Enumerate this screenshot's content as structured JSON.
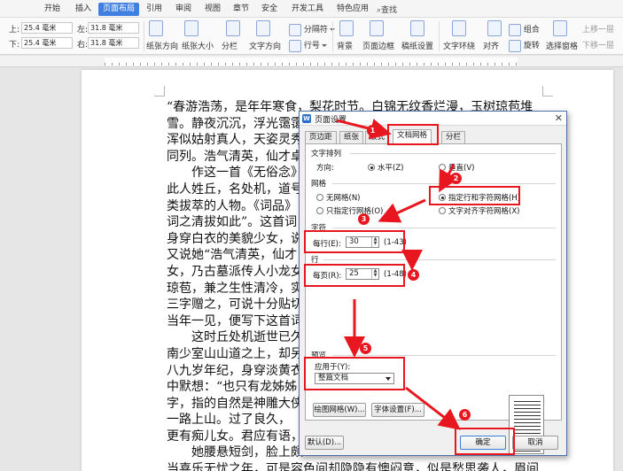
{
  "ribbon": {
    "tabs": [
      "开始",
      "插入",
      "页面布局",
      "引用",
      "审阅",
      "视图",
      "章节",
      "安全",
      "开发工具",
      "特色应用"
    ],
    "active_tab": "页面布局",
    "search_label": "查找",
    "margins": {
      "top_label": "上:",
      "top_value": "25.4 毫米",
      "bottom_label": "下:",
      "bottom_value": "25.4 毫米",
      "left_label": "左:",
      "left_value": "31.8 毫米",
      "right_label": "右:",
      "right_value": "31.8 毫米"
    },
    "tools": {
      "paper_direction": "纸张方向",
      "paper_size": "纸张大小",
      "columns": "分栏",
      "text_direction": "文字方向",
      "separator": "分隔符",
      "line_number": "行号",
      "background": "背景",
      "page_border": "页面边框",
      "manuscript": "稿纸设置",
      "text_wrap": "文字环绕",
      "align": "对齐",
      "group": "组合",
      "rotate": "旋转",
      "select_pane": "选择窗格",
      "bring_forward": "上移一层",
      "send_backward": "下移一层"
    }
  },
  "document": {
    "lines": [
      "“春游浩荡，是年年寒食，梨花时节。白锦无纹香烂漫，玉树琼苞堆",
      "雪。静夜沉沉，浮光霭霭",
      "浑似姑射真人，天姿灵秀",
      "同列。浩气清英，仙才卓荦",
      "　　作这一首《无俗念》词",
      "此人姓丘，名处机，道号",
      "类拔萃的人物。《词品》",
      "词之清拔如此”。这首词",
      "身穿白衣的美貌少女，说她",
      "又说她“浩气清英，仙才",
      "女，乃古墓派传人小龙女",
      "琼苞，兼之生性清冷，实",
      "三字赠之，可说十分贴切",
      "当年一见，便写下这首词",
      "　　这时丘处机逝世已久",
      "南少室山山道之上，却另",
      "八九岁年纪，身穿淡黄衣",
      "中默想：“也只有龙姊姊",
      "字，指的自然是神雕大侠",
      "一路上山。过了良久，",
      "更有痴儿女。君应有语，",
      "　　她腰悬短剑，脸上颇",
      "当喜乐无忧之年，可是容色间却隐隐有懊闷意，似是愁思袭人，眉间"
    ]
  },
  "dialog": {
    "title": "页面设置",
    "tabs": [
      "页边距",
      "纸张",
      "版式",
      "文档网格",
      "分栏"
    ],
    "active_tab": "文档网格",
    "text_layout": {
      "label": "文字排列",
      "direction_label": "方向:",
      "horizontal": "水平(Z)",
      "vertical": "垂直(V)",
      "selected": "水平(Z)"
    },
    "grid": {
      "label": "网格",
      "options": [
        "无网格(N)",
        "只指定行网格(O)",
        "指定行和字符网格(H)",
        "文字对齐字符网格(X)"
      ],
      "selected": "指定行和字符网格(H)"
    },
    "chars": {
      "label": "字符",
      "per_line_label": "每行(E):",
      "per_line_value": "30",
      "range": "(1-43)"
    },
    "lines": {
      "label": "行",
      "per_page_label": "每页(R):",
      "per_page_value": "25",
      "range": "(1-48)"
    },
    "preview": {
      "label": "预览",
      "apply_to_label": "应用于(Y):",
      "apply_to_value": "整篇文档"
    },
    "buttons": {
      "draw_grid": "绘图网格(W)...",
      "font_settings": "字体设置(F)...",
      "default": "默认(D)...",
      "ok": "确定",
      "cancel": "取消"
    }
  },
  "annotations": [
    "1",
    "2",
    "3",
    "4",
    "5",
    "6"
  ],
  "colors": {
    "accent": "#3f7fe0",
    "annotation_red": "#e8161e"
  }
}
